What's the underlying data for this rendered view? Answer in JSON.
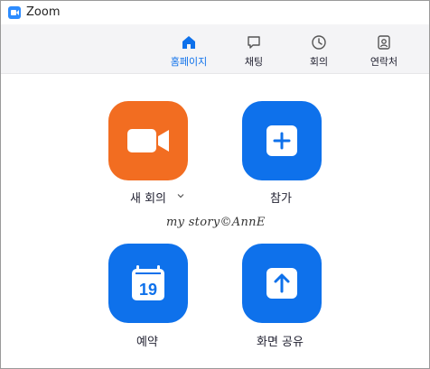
{
  "window": {
    "title": "Zoom"
  },
  "nav": {
    "tabs": [
      {
        "label": "홈페이지",
        "icon": "home-icon",
        "active": true
      },
      {
        "label": "채팅",
        "icon": "chat-icon",
        "active": false
      },
      {
        "label": "회의",
        "icon": "clock-icon",
        "active": false
      },
      {
        "label": "연락처",
        "icon": "contacts-icon",
        "active": false
      }
    ]
  },
  "actions": {
    "new_meeting": {
      "label": "새 회의",
      "icon": "video-camera-icon",
      "color": "#f26d21"
    },
    "join": {
      "label": "참가",
      "icon": "plus-icon",
      "color": "#0e71eb"
    },
    "schedule": {
      "label": "예약",
      "icon": "calendar-icon",
      "day": "19",
      "color": "#0e71eb"
    },
    "share_screen": {
      "label": "화면 공유",
      "icon": "arrow-up-icon",
      "color": "#0e71eb"
    }
  },
  "watermark": "my story©AnnE",
  "colors": {
    "accent": "#0e71eb",
    "orange": "#f26d21",
    "nav_bg": "#f4f4f6"
  }
}
